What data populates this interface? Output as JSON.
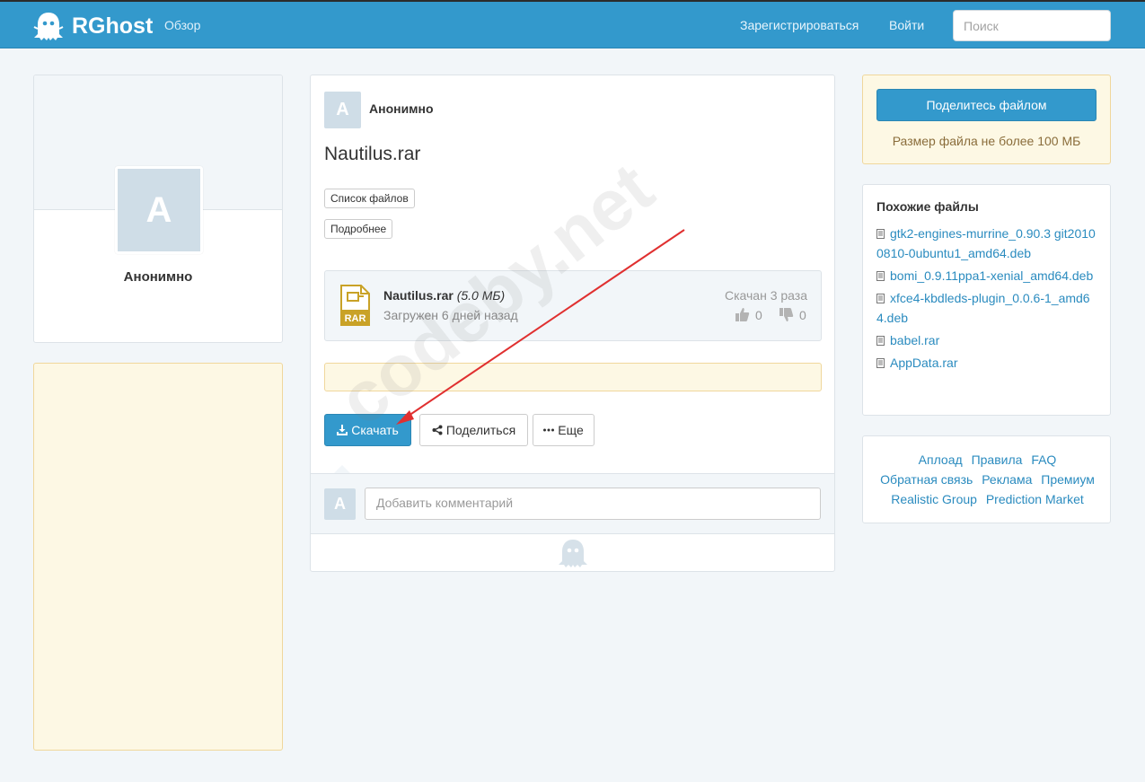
{
  "navbar": {
    "logo_text": "RGhost",
    "overview_link": "Обзор",
    "register_link": "Зарегистрироваться",
    "login_link": "Войти",
    "search_placeholder": "Поиск"
  },
  "profile": {
    "avatar_letter": "А",
    "name": "Анонимно"
  },
  "file": {
    "owner_avatar_letter": "А",
    "owner_name": "Анонимно",
    "title": "Nautilus.rar",
    "tag_files_label": "Список файлов",
    "tag_details_label": "Подробнее",
    "name": "Nautilus.rar",
    "size": "(5.0 МБ)",
    "uploaded": "Загружен 6 дней назад",
    "downloads": "Скачан 3 раза",
    "likes": "0",
    "dislikes": "0",
    "icon_label": "RAR"
  },
  "actions": {
    "download_label": "Скачать",
    "share_label": "Поделиться",
    "more_label": "Еще"
  },
  "comments": {
    "avatar_letter": "А",
    "placeholder": "Добавить комментарий"
  },
  "upload": {
    "button_label": "Поделитесь файлом",
    "note": "Размер файла не более 100 МБ"
  },
  "similar": {
    "title": "Похожие файлы",
    "items": [
      "gtk2-engines-murrine_0.90.3 git20100810-0ubuntu1_amd64.deb",
      "bomi_0.9.11ppa1-xenial_amd64.deb",
      "xfce4-kbdleds-plugin_0.0.6-1_amd64.deb",
      "babel.rar",
      "AppData.rar"
    ]
  },
  "footer_links": {
    "upload": "Аплоад",
    "rules": "Правила",
    "faq": "FAQ",
    "feedback": "Обратная связь",
    "ads": "Реклама",
    "premium": "Премиум",
    "realistic": "Realistic Group",
    "prediction": "Prediction Market"
  },
  "watermark": "codeby.net",
  "colors": {
    "brand": "#3399cc",
    "link": "#2a8bbf",
    "warning_bg": "#fdf8e4",
    "annotation_arrow": "#e03030"
  }
}
